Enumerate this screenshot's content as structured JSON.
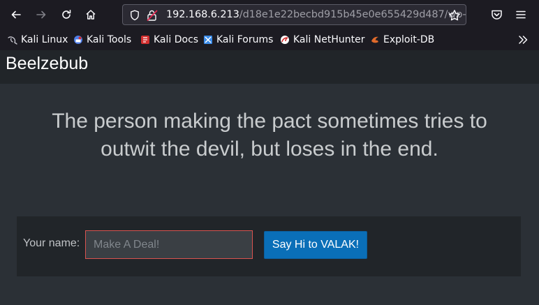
{
  "browser": {
    "url_host": "192.168.6.213",
    "url_path": "/d18e1e22becbd915b45e0e655429d487/wp-",
    "bookmarks": [
      {
        "label": "Kali Linux",
        "icon": "kali-dragon-icon",
        "color": "#cfcfd8"
      },
      {
        "label": "Kali Tools",
        "icon": "kali-tools-icon",
        "color": "#4f7ee8"
      },
      {
        "label": "Kali Docs",
        "icon": "kali-docs-icon",
        "color": "#d32f2f"
      },
      {
        "label": "Kali Forums",
        "icon": "kali-forums-icon",
        "color": "#3b8be8"
      },
      {
        "label": "Kali NetHunter",
        "icon": "nethunter-icon",
        "color": "#d32f2f"
      },
      {
        "label": "Exploit-DB",
        "icon": "exploit-db-icon",
        "color": "#e06a2b"
      }
    ]
  },
  "site": {
    "title": "Beelzebub",
    "tagline_line1": "The person making the pact sometimes tries to",
    "tagline_line2": "outwit the devil, but loses in the end."
  },
  "form": {
    "label": "Your name:",
    "input_value": "",
    "input_placeholder": "Make A Deal!",
    "button_label": "Say Hi to VALAK!"
  },
  "colors": {
    "page_bg": "#2b3036",
    "panel_bg": "#212529",
    "button_bg": "#0a6fb8",
    "input_border": "#d9534f"
  }
}
